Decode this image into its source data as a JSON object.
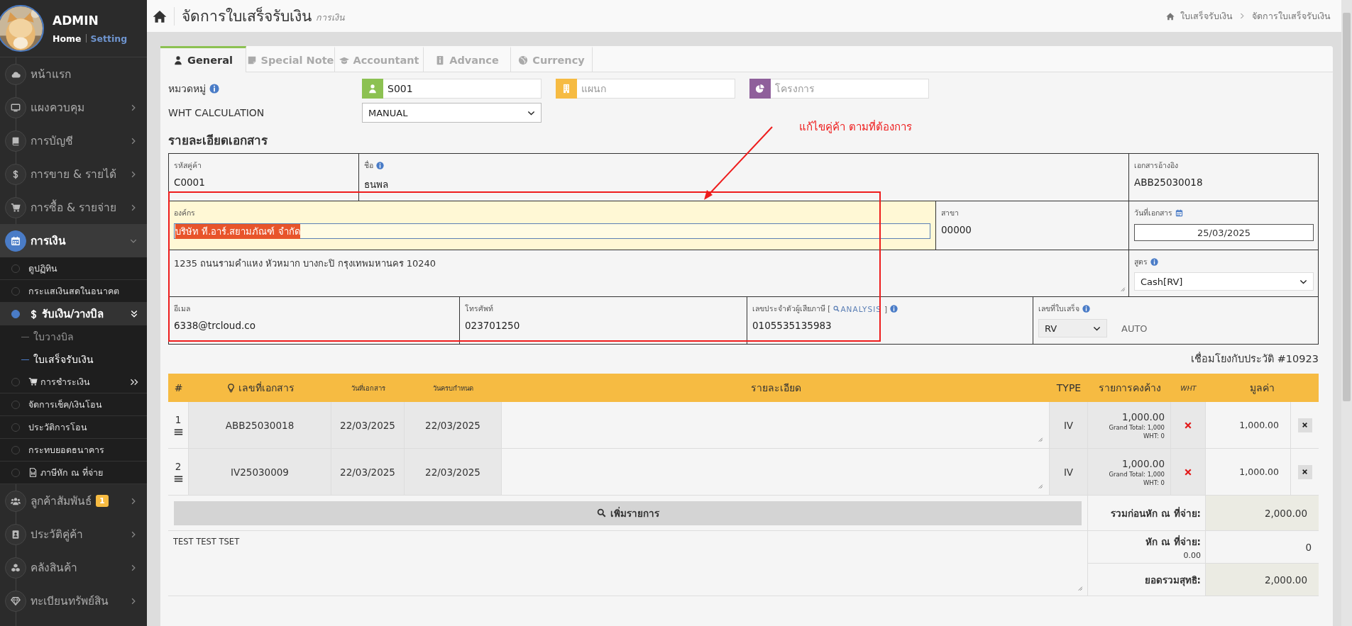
{
  "sidebar": {
    "user": {
      "name": "ADMIN",
      "links": [
        {
          "label": "Home",
          "selected": true
        },
        {
          "label": "Setting",
          "selected": false
        }
      ]
    },
    "items": [
      {
        "label": "หน้าแรก",
        "selected": false
      },
      {
        "label": "แผงควบคุม",
        "selected": false,
        "expanded": false
      },
      {
        "label": "การบัญชี",
        "selected": false,
        "expanded": false
      },
      {
        "label": "การขาย & รายได้",
        "selected": false,
        "expanded": false
      },
      {
        "label": "การซื้อ & รายจ่าย",
        "selected": false,
        "expanded": false
      },
      {
        "label": "การเงิน",
        "selected": true,
        "expanded": true,
        "children": [
          {
            "label": "ดูปฏิทิน",
            "selected": false
          },
          {
            "label": "กระแสเงินสดในอนาคต",
            "selected": false
          },
          {
            "label": "รับเงิน/วางบิล",
            "selected": true,
            "expanded": true,
            "children": [
              {
                "label": "ใบวางบิล",
                "selected": false
              },
              {
                "label": "ใบเสร็จรับเงิน",
                "selected": true
              }
            ]
          },
          {
            "label": "การชำระเงิน",
            "selected": false,
            "expanded": false
          },
          {
            "label": "จัดการเช็ค/เงินโอน",
            "selected": false
          },
          {
            "label": "ประวัติการโอน",
            "selected": false
          },
          {
            "label": "กระทบยอดธนาคาร",
            "selected": false
          },
          {
            "label": "ภาษีหัก ณ ที่จ่าย",
            "selected": false
          }
        ]
      },
      {
        "label": "ลูกค้าสัมพันธ์",
        "badge": "1",
        "selected": false,
        "expanded": false
      },
      {
        "label": "ประวัติคู่ค้า",
        "selected": false,
        "expanded": false
      },
      {
        "label": "คลังสินค้า",
        "selected": false,
        "expanded": false
      },
      {
        "label": "ทะเบียนทรัพย์สิน",
        "selected": false,
        "expanded": false
      }
    ]
  },
  "header": {
    "title": "จัดการใบเสร็จรับเงิน",
    "subtitle": "การเงิน",
    "breadcrumb": [
      "ใบเสร็จรับเงิน",
      "จัดการใบเสร็จรับเงิน"
    ]
  },
  "tabs": [
    {
      "label": "General",
      "selected": true
    },
    {
      "label": "Special Note",
      "selected": false
    },
    {
      "label": "Accountant",
      "selected": false
    },
    {
      "label": "Advance",
      "selected": false
    },
    {
      "label": "Currency",
      "selected": false
    }
  ],
  "form": {
    "category": {
      "label": "หมวดหมู่",
      "fields": [
        {
          "value": "S001",
          "color": "#8cc152"
        },
        {
          "placeholder": "แผนก",
          "color": "#f6bb42"
        },
        {
          "placeholder": "โครงการ",
          "color": "#8f609b"
        }
      ]
    },
    "wht": {
      "label": "WHT CALCULATION",
      "value": "MANUAL"
    }
  },
  "document": {
    "title": "รายละเอียดเอกสาร",
    "customer_code": {
      "label": "รหัสคู่ค้า",
      "value": "C0001"
    },
    "name": {
      "label": "ชื่อ",
      "value": "ธนพล"
    },
    "reference": {
      "label": "เอกสารอ้างอิง",
      "value": "ABB25030018"
    },
    "organization": {
      "label": "องค์กร",
      "value": "บริษัท ที.อาร์.สยามภัณฑ์ จำกัด",
      "highlighted": true
    },
    "branch": {
      "label": "สาขา",
      "value": "00000"
    },
    "doc_date": {
      "label": "วันที่เอกสาร",
      "value": "25/03/2025"
    },
    "address": {
      "value": "1235 ถนนรามคำแหง หัวหมาก บางกะปิ กรุงเทพมหานคร 10240"
    },
    "formula": {
      "label": "สูตร",
      "value": "Cash[RV]"
    },
    "email": {
      "label": "อีเมล",
      "value": "6338@trcloud.co"
    },
    "phone": {
      "label": "โทรศัพท์",
      "value": "023701250"
    },
    "tax_id": {
      "label": "เลขประจำตัวผู้เสียภาษี [",
      "link": "ANALYSIS",
      "label_end": "]",
      "value": "0105535135983"
    },
    "receipt_no": {
      "label": "เลขที่ใบเสร็จ",
      "value": "RV",
      "mode": "AUTO"
    }
  },
  "link_note": "เชื่อมโยงกับประวัติ #10923",
  "items": {
    "columns": [
      "#",
      "เลขที่เอกสาร",
      "วันที่เอกสาร",
      "วันครบกำหนด",
      "รายละเอียด",
      "TYPE",
      "รายการคงค้าง",
      "WHT",
      "มูลค่า"
    ],
    "rows": [
      {
        "no": "1",
        "doc": "ABB25030018",
        "date": "22/03/2025",
        "due": "22/03/2025",
        "type": "IV",
        "outstanding": "1,000.00",
        "grand_total": "Grand Total: 1,000",
        "wht_line": "WHT: 0",
        "wht_applied": false,
        "value": "1,000.00"
      },
      {
        "no": "2",
        "doc": "IV25030009",
        "date": "22/03/2025",
        "due": "22/03/2025",
        "type": "IV",
        "outstanding": "1,000.00",
        "grand_total": "Grand Total: 1,000",
        "wht_line": "WHT: 0",
        "wht_applied": false,
        "value": "1,000.00"
      }
    ],
    "add_button": "เพิ่มรายการ",
    "note": "TEST TEST TSET",
    "totals": [
      {
        "label": "รวมก่อนหัก ณ ที่จ่าย:",
        "value": "2,000.00",
        "kind": "computed"
      },
      {
        "label": "หัก ณ ที่จ่าย:",
        "sub": "0.00",
        "value": "0",
        "kind": "input"
      },
      {
        "label": "ยอดรวมสุทธิ:",
        "value": "2,000.00",
        "kind": "computed"
      }
    ]
  },
  "annotation": {
    "text": "แก้ไขคู่ค้า ตามที่ต้องการ"
  }
}
